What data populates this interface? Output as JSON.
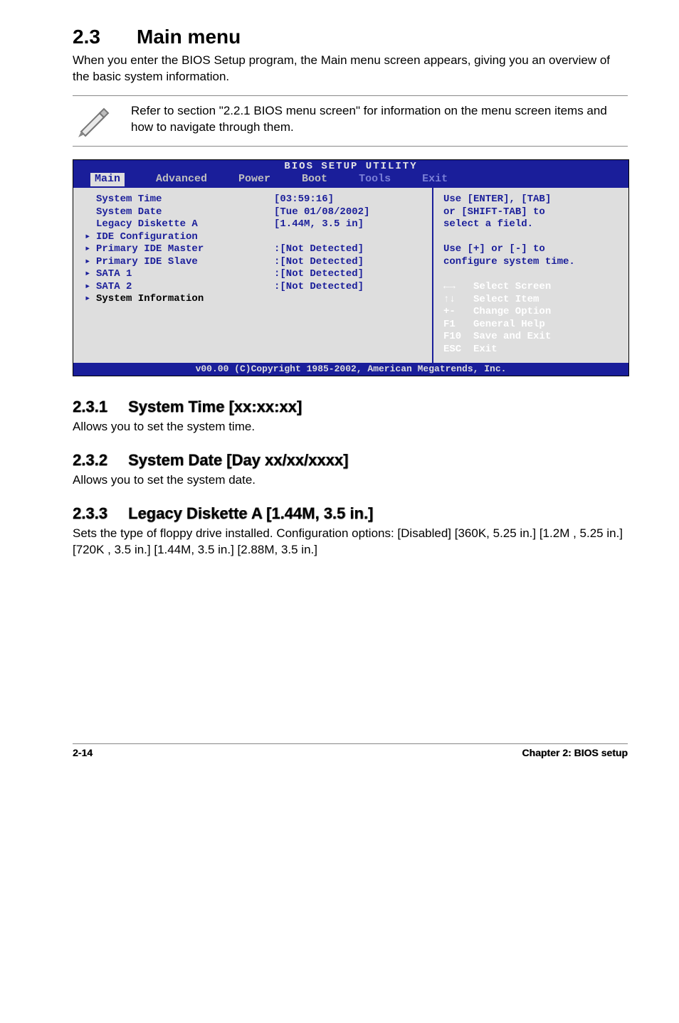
{
  "section": {
    "num": "2.3",
    "title": "Main menu"
  },
  "intro": "When you enter the BIOS Setup program, the Main menu screen appears, giving you an overview of the basic system information.",
  "note": "Refer to section \"2.2.1  BIOS menu screen\" for information on the menu screen items and how to navigate through them.",
  "bios": {
    "title": "BIOS SETUP UTILITY",
    "menu": [
      "Main",
      "Advanced",
      "Power",
      "Boot",
      "Tools",
      "Exit"
    ],
    "footer": "v00.00 (C)Copyright 1985-2002, American Megatrends, Inc.",
    "left": [
      {
        "label": "System Time",
        "value": "[03:59:16]",
        "arrow": false,
        "black": false
      },
      {
        "label": "System Date",
        "value": "[Tue 01/08/2002]",
        "arrow": false,
        "black": false
      },
      {
        "label": "Legacy Diskette A",
        "value": "[1.44M, 3.5 in]",
        "arrow": false,
        "black": false
      },
      {
        "label": "",
        "value": "",
        "arrow": false,
        "black": false
      },
      {
        "label": "IDE Configuration",
        "value": "",
        "arrow": true,
        "black": false
      },
      {
        "label": "",
        "value": "",
        "arrow": false,
        "black": false
      },
      {
        "label": "Primary IDE Master",
        "value": ":[Not Detected]",
        "arrow": true,
        "black": false
      },
      {
        "label": "Primary IDE Slave",
        "value": ":[Not Detected]",
        "arrow": true,
        "black": false
      },
      {
        "label": "SATA 1",
        "value": ":[Not Detected]",
        "arrow": true,
        "black": false
      },
      {
        "label": "",
        "value": "",
        "arrow": false,
        "black": false
      },
      {
        "label": "SATA 2",
        "value": ":[Not Detected]",
        "arrow": true,
        "black": false
      },
      {
        "label": "",
        "value": "",
        "arrow": false,
        "black": false
      },
      {
        "label": "System Information",
        "value": "",
        "arrow": true,
        "black": true
      }
    ],
    "help_top": [
      "Use [ENTER], [TAB]",
      "or [SHIFT-TAB] to",
      "select a field.",
      "",
      "Use [+] or [-] to",
      "configure system time."
    ],
    "keys": [
      {
        "k": "←→",
        "d": "Select Screen"
      },
      {
        "k": "↑↓",
        "d": "Select Item"
      },
      {
        "k": "+-",
        "d": "Change Option"
      },
      {
        "k": "F1",
        "d": "General Help"
      },
      {
        "k": "F10",
        "d": "Save and Exit"
      },
      {
        "k": "ESC",
        "d": "Exit"
      }
    ]
  },
  "subs": [
    {
      "num": "2.3.1",
      "title": "System Time [xx:xx:xx]",
      "body": "Allows you to set the system time."
    },
    {
      "num": "2.3.2",
      "title": "System Date [Day xx/xx/xxxx]",
      "body": "Allows you to set the system date."
    },
    {
      "num": "2.3.3",
      "title": "Legacy Diskette A [1.44M, 3.5 in.]",
      "body": "Sets the type of floppy drive installed. Configuration options: [Disabled] [360K, 5.25 in.] [1.2M , 5.25 in.] [720K , 3.5 in.] [1.44M, 3.5 in.] [2.88M, 3.5 in.]"
    }
  ],
  "footer": {
    "left": "2-14",
    "right": "Chapter 2: BIOS setup"
  }
}
